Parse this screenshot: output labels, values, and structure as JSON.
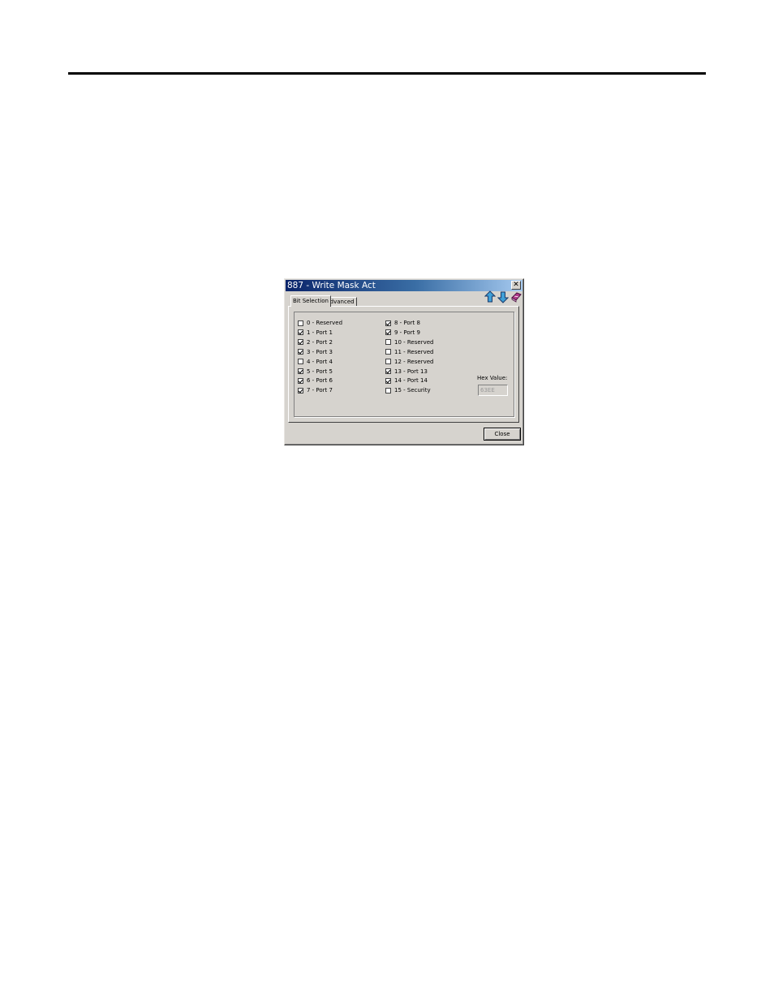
{
  "dialog": {
    "title": "887 - Write Mask Act",
    "close_glyph": "✕",
    "tabs": [
      {
        "label": "Bit Selection",
        "active": true
      },
      {
        "label": "Advanced",
        "active": false
      }
    ],
    "toolbar_icons": [
      "arrow-up-icon",
      "arrow-down-icon",
      "help-book-icon"
    ],
    "bits": [
      {
        "label": "0 - Reserved",
        "checked": false
      },
      {
        "label": "1 - Port 1",
        "checked": true
      },
      {
        "label": "2 - Port 2",
        "checked": true
      },
      {
        "label": "3 - Port 3",
        "checked": true
      },
      {
        "label": "4 - Port 4",
        "checked": false
      },
      {
        "label": "5 - Port 5",
        "checked": true
      },
      {
        "label": "6 - Port 6",
        "checked": true
      },
      {
        "label": "7 - Port 7",
        "checked": true
      },
      {
        "label": "8 - Port 8",
        "checked": true
      },
      {
        "label": "9 - Port 9",
        "checked": true
      },
      {
        "label": "10 - Reserved",
        "checked": false
      },
      {
        "label": "11 - Reserved",
        "checked": false
      },
      {
        "label": "12 - Reserved",
        "checked": false
      },
      {
        "label": "13 - Port 13",
        "checked": true
      },
      {
        "label": "14 - Port 14",
        "checked": true
      },
      {
        "label": "15 - Security",
        "checked": false
      }
    ],
    "hex_label": "Hex Value:",
    "hex_value": "63EE",
    "close_label": "Close"
  },
  "colors": {
    "title_bar": "#0a246a",
    "dialog_face": "#d6d3ce"
  }
}
